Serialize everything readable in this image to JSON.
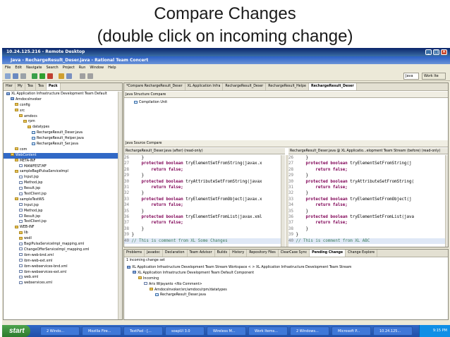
{
  "slide": {
    "title_line1": "Compare Changes",
    "title_line2": "(double click on incoming change)"
  },
  "remote": {
    "title": "10.24.125.216 - Remote Desktop"
  },
  "window": {
    "title": "Java - RechargeResult_Deser.java - Rational Team Concert"
  },
  "menu": [
    "File",
    "Edit",
    "Navigate",
    "Search",
    "Project",
    "Run",
    "Window",
    "Help"
  ],
  "perspectives": {
    "java": "Java",
    "work": "Work Ite"
  },
  "left_tabs": [
    "Hier",
    "My",
    "Tea",
    "Tea",
    "Pack"
  ],
  "left_tree": [
    {
      "t": "XL Application Infrastructure Development Team Default",
      "d": 0,
      "k": "proj"
    },
    {
      "t": "AmdocsInvoker",
      "d": 1,
      "k": "proj"
    },
    {
      "t": "config",
      "d": 2,
      "k": "fold"
    },
    {
      "t": "src",
      "d": 2,
      "k": "fold"
    },
    {
      "t": "amdocs",
      "d": 3,
      "k": "fold"
    },
    {
      "t": "rpm",
      "d": 4,
      "k": "fold"
    },
    {
      "t": "datatypes",
      "d": 5,
      "k": "fold"
    },
    {
      "t": "RechargeResult_Deser.java",
      "d": 6,
      "k": "jv"
    },
    {
      "t": "RechargeResult_Helper.java",
      "d": 6,
      "k": "jv"
    },
    {
      "t": "RechargeResult_Ser.java",
      "d": 6,
      "k": "jv"
    },
    {
      "t": "com",
      "d": 2,
      "k": "fold"
    },
    {
      "t": "WebContent",
      "d": 1,
      "k": "fold",
      "sel": true
    },
    {
      "t": "META-INF",
      "d": 2,
      "k": "fold"
    },
    {
      "t": "MANIFEST.MF",
      "d": 3,
      "k": "file"
    },
    {
      "t": "sampleBagiPulsaServiceImpl",
      "d": 2,
      "k": "fold"
    },
    {
      "t": "Input.jsp",
      "d": 3,
      "k": "file"
    },
    {
      "t": "Method.jsp",
      "d": 3,
      "k": "file"
    },
    {
      "t": "Result.jsp",
      "d": 3,
      "k": "file"
    },
    {
      "t": "TestClient.jsp",
      "d": 3,
      "k": "file"
    },
    {
      "t": "sampleTestWS",
      "d": 2,
      "k": "fold"
    },
    {
      "t": "Input.jsp",
      "d": 3,
      "k": "file"
    },
    {
      "t": "Method.jsp",
      "d": 3,
      "k": "file"
    },
    {
      "t": "Result.jsp",
      "d": 3,
      "k": "file"
    },
    {
      "t": "TestClient.jsp",
      "d": 3,
      "k": "file"
    },
    {
      "t": "WEB-INF",
      "d": 2,
      "k": "fold"
    },
    {
      "t": "lib",
      "d": 3,
      "k": "fold"
    },
    {
      "t": "wsdl",
      "d": 3,
      "k": "fold"
    },
    {
      "t": "BagiPulsaServiceImpl_mapping.xml",
      "d": 3,
      "k": "file"
    },
    {
      "t": "ChangeOfferServiceImpl_mapping.xml",
      "d": 3,
      "k": "file"
    },
    {
      "t": "ibm-web-bnd.xml",
      "d": 3,
      "k": "file"
    },
    {
      "t": "ibm-web-ext.xml",
      "d": 3,
      "k": "file"
    },
    {
      "t": "ibm-webservices-bnd.xml",
      "d": 3,
      "k": "file"
    },
    {
      "t": "ibm-webservices-ext.xml",
      "d": 3,
      "k": "file"
    },
    {
      "t": "web.xml",
      "d": 3,
      "k": "file"
    },
    {
      "t": "webservices.xml",
      "d": 3,
      "k": "file"
    }
  ],
  "editor_tabs": [
    "*Compare RechargeResult_Deser",
    "XL Application Infra",
    "RechargeResult_Deser",
    "RechargeResult_Helpe",
    "RechargeResult_Deser"
  ],
  "structure": {
    "header": "Java Structure Compare",
    "item": "Compilation Unit"
  },
  "source": {
    "header": "Java Source Compare",
    "left_title": "RechargeResult_Deser.java (after) (read-only)",
    "right_title": "RechargeResult_Deser.java @ XL Applicatio...elopment Team Stream (before) (read-only)",
    "left": [
      {
        "n": "26",
        "c": "    }"
      },
      {
        "n": "27",
        "k": "    protected boolean",
        "c": " tryElementSetFromString(javax.x"
      },
      {
        "n": "28",
        "k": "        return false;",
        "c": ""
      },
      {
        "n": "29",
        "c": "    }"
      },
      {
        "n": "30",
        "k": "    protected boolean",
        "c": " tryAttributeSetFromString(javax"
      },
      {
        "n": "31",
        "k": "        return false;",
        "c": ""
      },
      {
        "n": "32",
        "c": "    }"
      },
      {
        "n": "33",
        "k": "    protected boolean",
        "c": " tryElementSetFromObject(javax.x"
      },
      {
        "n": "34",
        "k": "        return false;",
        "c": ""
      },
      {
        "n": "35",
        "c": "    }"
      },
      {
        "n": "36",
        "k": "    protected boolean",
        "c": " tryElementSetFromList(javax.xml"
      },
      {
        "n": "37",
        "k": "        return false;",
        "c": ""
      },
      {
        "n": "38",
        "c": "    }"
      },
      {
        "n": "39",
        "c": "}"
      },
      {
        "n": "40",
        "cm": "// This is comment from XL Some Changes"
      }
    ],
    "right": [
      {
        "n": "26",
        "c": "    }"
      },
      {
        "n": "27",
        "k": "    protected boolean",
        "c": " tryElementSetFromString(j"
      },
      {
        "n": "28",
        "k": "        return false;",
        "c": ""
      },
      {
        "n": "29",
        "c": "    }"
      },
      {
        "n": "30",
        "k": "    protected boolean",
        "c": " tryAttributeSetFromString("
      },
      {
        "n": "31",
        "k": "        return false;",
        "c": ""
      },
      {
        "n": "32",
        "c": "    }"
      },
      {
        "n": "33",
        "k": "    protected boolean",
        "c": " tryElementSetFromObject(j"
      },
      {
        "n": "34",
        "k": "        return false;",
        "c": ""
      },
      {
        "n": "35",
        "c": "    }"
      },
      {
        "n": "36",
        "k": "    protected boolean",
        "c": " tryElementSetFromList(java"
      },
      {
        "n": "37",
        "k": "        return false;",
        "c": ""
      },
      {
        "n": "38",
        "c": "    }"
      },
      {
        "n": "39",
        "c": "}"
      },
      {
        "n": "40",
        "cm": "// This is comment from XL ABC"
      }
    ]
  },
  "bottom_tabs": [
    "Problems",
    "Javadoc",
    "Declaration",
    "Team Advisor",
    "Builds",
    "History",
    "Repository Files",
    "ClearCase Sync",
    "Pending Change",
    "Change Explore"
  ],
  "pending": {
    "summary": "1 incoming change set",
    "tree": [
      {
        "t": "XL Application Infrastructure Development Team Stream Workspace < > XL Application Infrastructure Development Team Stream",
        "d": 0,
        "k": "proj"
      },
      {
        "t": "XL Application Infrastructure Development Team Default Component",
        "d": 1,
        "k": "proj"
      },
      {
        "t": "Incoming",
        "d": 2,
        "k": "fold"
      },
      {
        "t": "Aris Wijayanto  <No Comment>",
        "d": 3,
        "k": "file"
      },
      {
        "t": "AmdocsInvoker/src/amdocs/rpm/datatypes",
        "d": 4,
        "k": "fold"
      },
      {
        "t": "RechargeResult_Deser.java",
        "d": 5,
        "k": "jv"
      }
    ]
  },
  "taskbar": {
    "start": "start",
    "items": [
      "2 Windo...",
      "Mozilla Fire...",
      "TextPad - [...",
      "soapUI 3.0",
      "Wireless M...",
      "Work Items...",
      "2 Windows...",
      "Microsoft P...",
      "10.24.125..."
    ],
    "clock": "9:15 PM"
  }
}
